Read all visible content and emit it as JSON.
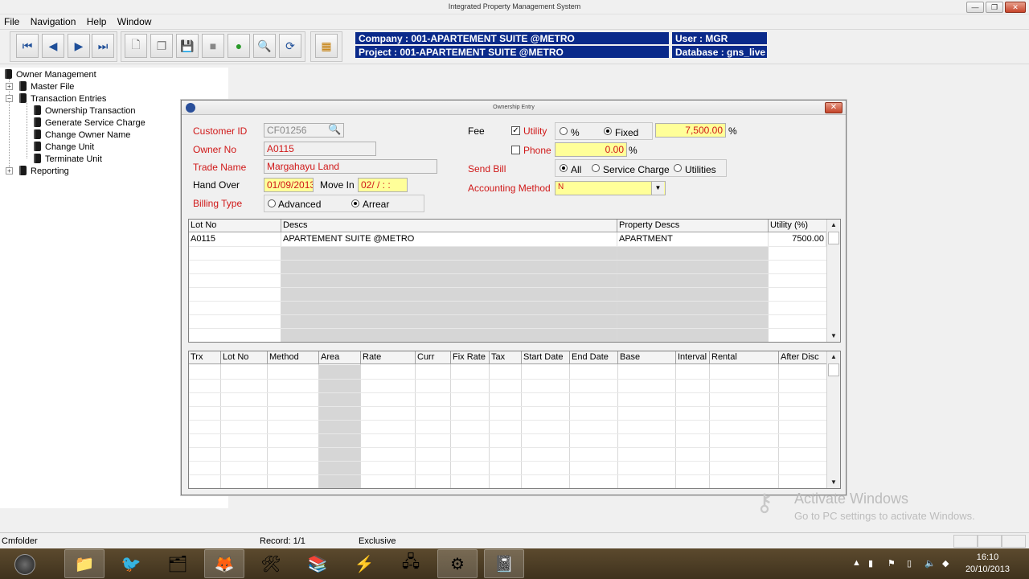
{
  "app": {
    "title": "Integrated Property Management System",
    "win_min": "—",
    "win_max": "❐",
    "win_close": "✕"
  },
  "menu": [
    "File",
    "Navigation",
    "Help",
    "Window"
  ],
  "toolbar": {
    "buttons": [
      "first-record-icon",
      "previous-record-icon",
      "next-record-icon",
      "last-record-icon",
      "new-document-icon",
      "copy-icon",
      "save-icon",
      "delete-icon",
      "refresh-icon",
      "search-icon",
      "reload-icon",
      "calculator-icon"
    ],
    "company": "Company : 001-APARTEMENT SUITE @METRO",
    "project": "Project : 001-APARTEMENT SUITE @METRO",
    "user": "User : MGR",
    "database": "Database : gns_live"
  },
  "tree": {
    "root": "Owner Management",
    "master_file": "Master File",
    "transaction_entries": "Transaction Entries",
    "children": [
      "Ownership Transaction",
      "Generate Service Charge",
      "Change Owner Name",
      "Change Unit",
      "Terminate Unit"
    ],
    "reporting": "Reporting"
  },
  "form": {
    "window_title": "Ownership Entry",
    "customer_id_label": "Customer ID",
    "customer_id": "CF01256",
    "owner_no_label": "Owner No",
    "owner_no": "A0115",
    "trade_name_label": "Trade Name",
    "trade_name": "Margahayu Land",
    "hand_over_label": "Hand Over",
    "hand_over": "01/09/2013",
    "move_in_label": "Move In",
    "move_in": "02/  /      :  :",
    "billing_type_label": "Billing Type",
    "billing_advanced": "Advanced",
    "billing_arrear": "Arrear",
    "fee_label": "Fee",
    "utility_label": "Utility",
    "percent_label": "%",
    "fixed_label": "Fixed",
    "utility_amount": "7,500.00",
    "pct_sign": "%",
    "phone_label": "Phone",
    "phone_amount": "0.00",
    "send_bill_label": "Send Bill",
    "send_all": "All",
    "send_service": "Service Charge",
    "send_utilities": "Utilities",
    "accounting_method_label": "Accounting Method",
    "accounting_method": "N"
  },
  "lot_grid": {
    "headers": [
      "Lot No",
      "Descs",
      "Property Descs",
      "Utility (%)"
    ],
    "rows": [
      [
        "A0115",
        "APARTEMENT SUITE @METRO",
        "APARTMENT",
        "7500.00"
      ]
    ]
  },
  "trx_grid": {
    "headers": [
      "Trx",
      "Lot No",
      "Method",
      "Area",
      "Rate",
      "Curr",
      "Fix Rate",
      "Tax",
      "Start Date",
      "End Date",
      "Base",
      "Interval",
      "Rental",
      "After Disc"
    ]
  },
  "status": {
    "left": "Cmfolder",
    "record": "Record: 1/1",
    "mode": "Exclusive"
  },
  "watermark": {
    "line1": "Activate Windows",
    "line2": "Go to PC settings to activate Windows."
  },
  "taskbar": {
    "time": "16:10",
    "date": "20/10/2013"
  }
}
